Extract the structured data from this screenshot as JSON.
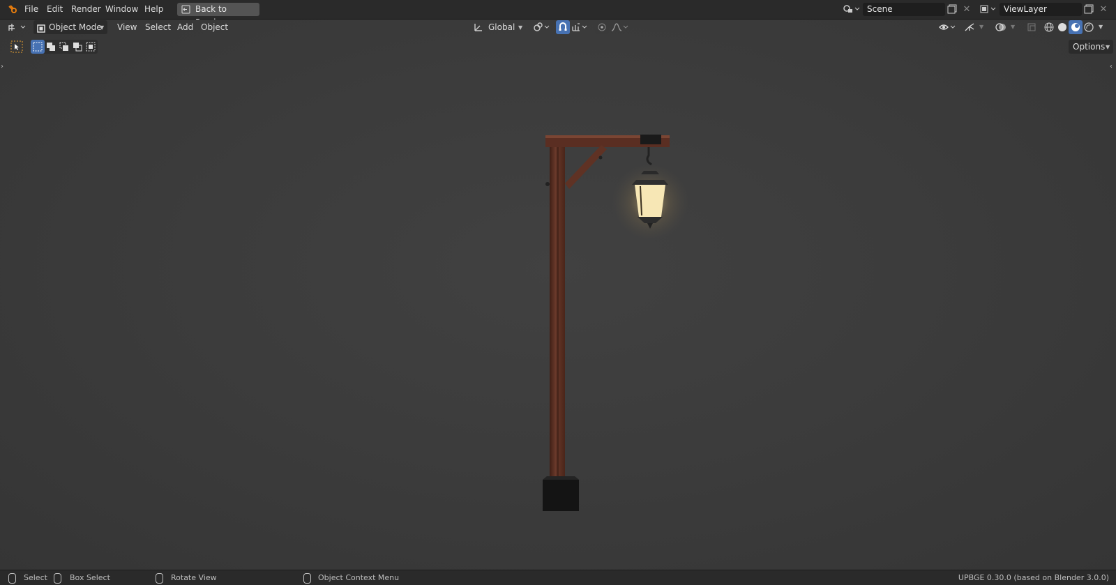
{
  "topbar": {
    "menu": [
      "File",
      "Edit",
      "Render",
      "Window",
      "Help"
    ],
    "back_button": "Back to Previous",
    "scene_name": "Scene",
    "view_layer_name": "ViewLayer"
  },
  "viewport_header": {
    "mode": "Object Mode",
    "menus": [
      "View",
      "Select",
      "Add",
      "Object"
    ],
    "transform_orientation": "Global",
    "options_label": "Options"
  },
  "statusbar": {
    "select": "Select",
    "box_select": "Box Select",
    "rotate_view": "Rotate View",
    "context_menu": "Object Context Menu",
    "version": "UPBGE 0.30.0 (based on Blender 3.0.0)"
  },
  "colors": {
    "accent_blue": "#4772b3",
    "lamp_glow": "#f7e7b5",
    "wood": "#5a2e22"
  }
}
